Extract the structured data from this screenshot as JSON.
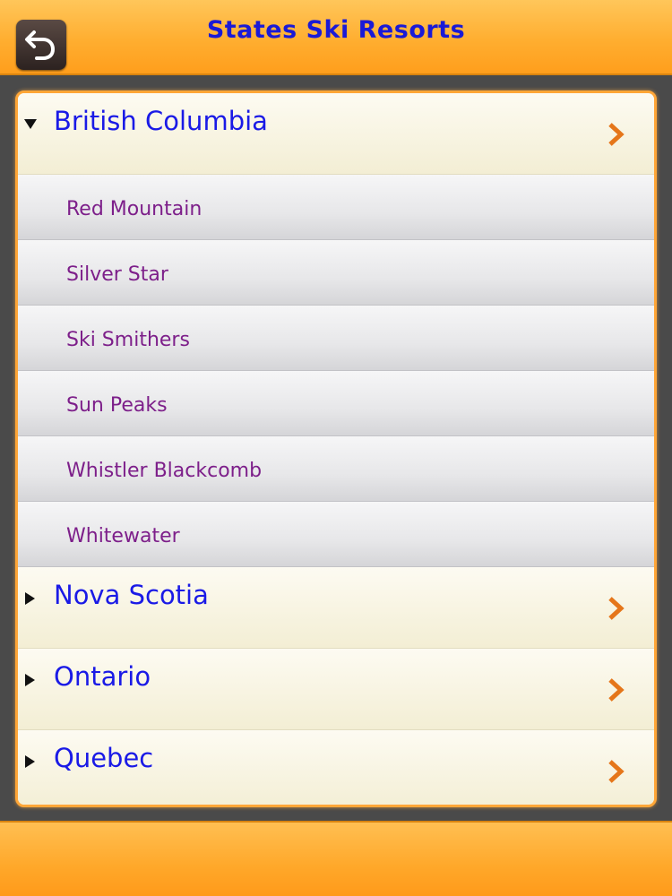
{
  "header": {
    "title": "States Ski Resorts",
    "back_icon": "back-arrow-icon"
  },
  "list": {
    "groups": [
      {
        "label": "British Columbia",
        "expanded": true,
        "items": [
          {
            "label": "Red Mountain"
          },
          {
            "label": "Silver Star"
          },
          {
            "label": "Ski Smithers"
          },
          {
            "label": "Sun Peaks"
          },
          {
            "label": "Whistler Blackcomb"
          },
          {
            "label": "Whitewater"
          }
        ]
      },
      {
        "label": "Nova Scotia",
        "expanded": false
      },
      {
        "label": "Ontario",
        "expanded": false
      },
      {
        "label": "Quebec",
        "expanded": false
      }
    ]
  },
  "colors": {
    "accent_orange": "#ffa637",
    "title_blue": "#1a1ad6",
    "group_blue": "#1a1ae6",
    "item_purple": "#7d1f8a",
    "chevron_orange": "#e5761a"
  }
}
